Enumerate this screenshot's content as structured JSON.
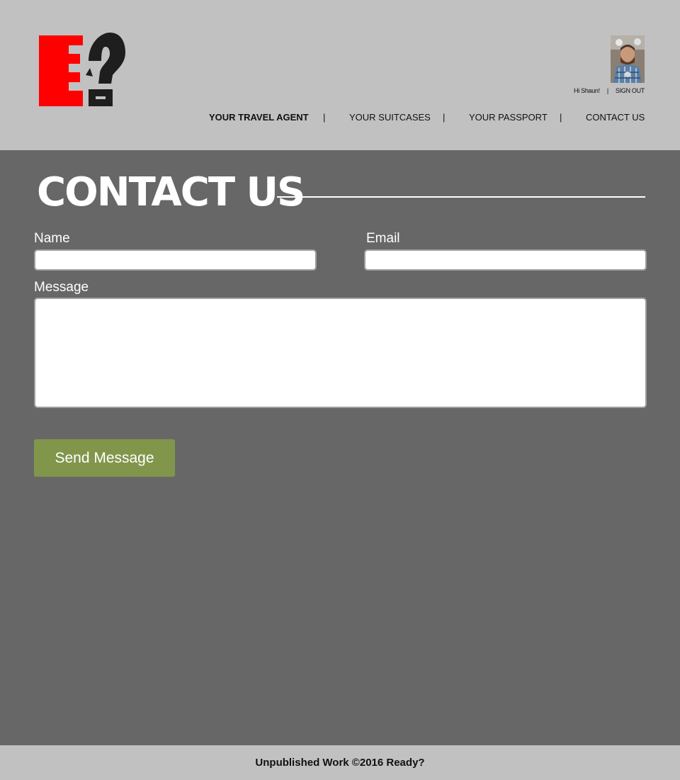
{
  "header": {
    "logo_text": "E?",
    "user": {
      "greeting": "Hi Shaun!",
      "separator": "|",
      "sign_out": "SIGN OUT"
    },
    "nav": {
      "items": [
        {
          "label": "YOUR TRAVEL AGENT",
          "active": true
        },
        {
          "label": "YOUR SUITCASES",
          "active": false
        },
        {
          "label": "YOUR PASSPORT",
          "active": false
        },
        {
          "label": "CONTACT US",
          "active": false
        }
      ],
      "separator": "|"
    }
  },
  "main": {
    "title": "CONTACT US",
    "form": {
      "name_label": "Name",
      "name_value": "",
      "email_label": "Email",
      "email_value": "",
      "message_label": "Message",
      "message_value": "",
      "submit_label": "Send Message"
    }
  },
  "footer": {
    "text": "Unpublished Work ©2016 Ready?"
  },
  "colors": {
    "header_bg": "#c1c1c1",
    "main_bg": "#676767",
    "logo_red": "#ff0000",
    "logo_dark": "#1e1e1e",
    "button_green": "#82964b"
  }
}
